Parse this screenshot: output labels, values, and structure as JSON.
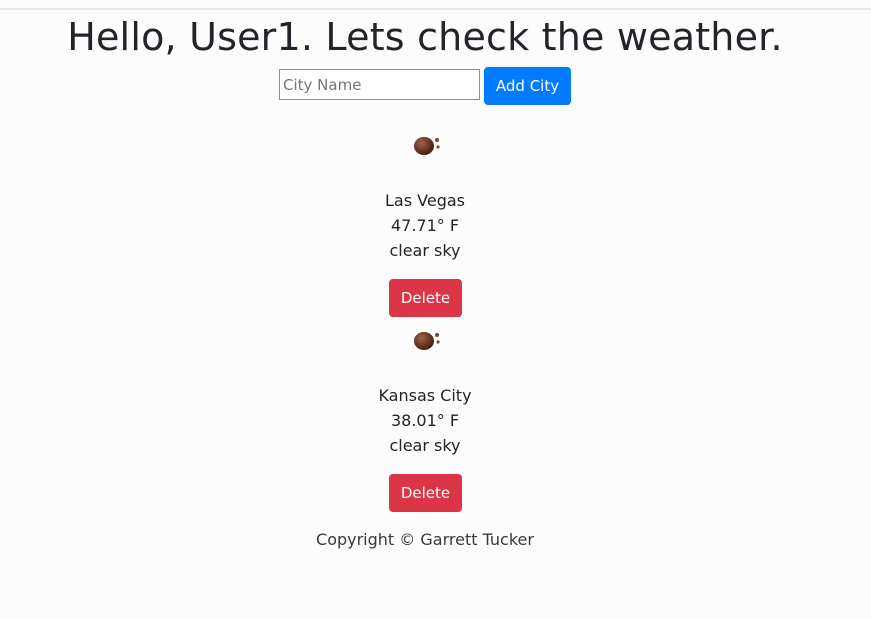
{
  "header": {
    "greeting": "Hello, User1. Lets check the weather."
  },
  "form": {
    "placeholder": "City Name",
    "value": "",
    "add_label": "Add City"
  },
  "cities": [
    {
      "icon": "weather-rock-icon",
      "name": "Las Vegas",
      "temp": "47.71° F",
      "description": "clear sky",
      "delete_label": "Delete"
    },
    {
      "icon": "weather-rock-icon",
      "name": "Kansas City",
      "temp": "38.01° F",
      "description": "clear sky",
      "delete_label": "Delete"
    }
  ],
  "footer": {
    "copyright": "Copyright © Garrett Tucker"
  },
  "colors": {
    "primary": "#007bff",
    "danger": "#dc3545"
  }
}
